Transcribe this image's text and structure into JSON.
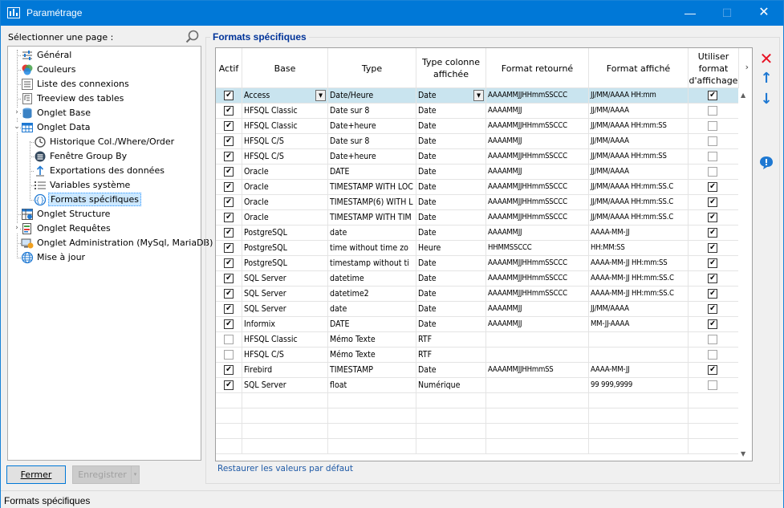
{
  "window": {
    "title": "Paramétrage"
  },
  "left": {
    "label": "Sélectionner une page :"
  },
  "tree": [
    {
      "label": "Général",
      "icon": "settings-sliders-icon",
      "level": 0,
      "expander": ""
    },
    {
      "label": "Couleurs",
      "icon": "color-palette-icon",
      "level": 0,
      "expander": ""
    },
    {
      "label": "Liste des connexions",
      "icon": "list-icon",
      "level": 0,
      "expander": ""
    },
    {
      "label": "Treeview des tables",
      "icon": "treeview-icon",
      "level": 0,
      "expander": ""
    },
    {
      "label": "Onglet Base",
      "icon": "database-icon",
      "level": 0,
      "expander": "›"
    },
    {
      "label": "Onglet Data",
      "icon": "table-icon",
      "level": 0,
      "expander": "⌄"
    },
    {
      "label": "Historique Col./Where/Order",
      "icon": "history-icon",
      "level": 1,
      "expander": ""
    },
    {
      "label": "Fenêtre Group By",
      "icon": "group-by-icon",
      "level": 1,
      "expander": ""
    },
    {
      "label": "Exportations des données",
      "icon": "export-icon",
      "level": 1,
      "expander": ""
    },
    {
      "label": "Variables système",
      "icon": "variables-icon",
      "level": 1,
      "expander": ""
    },
    {
      "label": "Formats spécifiques",
      "icon": "format-braces-icon",
      "level": 1,
      "expander": "",
      "selected": true
    },
    {
      "label": "Onglet Structure",
      "icon": "structure-icon",
      "level": 0,
      "expander": ""
    },
    {
      "label": "Onglet Requêtes",
      "icon": "query-icon",
      "level": 0,
      "expander": "›"
    },
    {
      "label": "Onglet Administration (MySql, MariaDB)",
      "icon": "admin-icon",
      "level": 0,
      "expander": ""
    },
    {
      "label": "Mise à jour",
      "icon": "globe-icon",
      "level": 0,
      "expander": ""
    }
  ],
  "buttons": {
    "close": "Fermer",
    "save": "Enregistrer"
  },
  "group": {
    "title": "Formats spécifiques"
  },
  "table": {
    "headers": [
      "Actif",
      "Base",
      "Type",
      "Type colonne affichée",
      "Format retourné",
      "Format affiché",
      "Utiliser format d'affichage"
    ],
    "rows": [
      {
        "actif": true,
        "base": "Access",
        "type": "Date/Heure",
        "col": "Date",
        "ret": "AAAAMMJJHHmmSSCCC",
        "aff": "JJ/MM/AAAA HH:mm",
        "use": true
      },
      {
        "actif": true,
        "base": "HFSQL Classic",
        "type": "Date sur 8",
        "col": "Date",
        "ret": "AAAAMMJJ",
        "aff": "JJ/MM/AAAA",
        "use": false
      },
      {
        "actif": true,
        "base": "HFSQL Classic",
        "type": "Date+heure",
        "col": "Date",
        "ret": "AAAAMMJJHHmmSSCCC",
        "aff": "JJ/MM/AAAA HH:mm:SS",
        "use": false
      },
      {
        "actif": true,
        "base": "HFSQL C/S",
        "type": "Date sur 8",
        "col": "Date",
        "ret": "AAAAMMJJ",
        "aff": "JJ/MM/AAAA",
        "use": false
      },
      {
        "actif": true,
        "base": "HFSQL C/S",
        "type": "Date+heure",
        "col": "Date",
        "ret": "AAAAMMJJHHmmSSCCC",
        "aff": "JJ/MM/AAAA HH:mm:SS",
        "use": false
      },
      {
        "actif": true,
        "base": "Oracle",
        "type": "DATE",
        "col": "Date",
        "ret": "AAAAMMJJ",
        "aff": "JJ/MM/AAAA",
        "use": false
      },
      {
        "actif": true,
        "base": "Oracle",
        "type": "TIMESTAMP WITH LOC",
        "col": "Date",
        "ret": "AAAAMMJJHHmmSSCCC",
        "aff": "JJ/MM/AAAA HH:mm:SS.C",
        "use": true
      },
      {
        "actif": true,
        "base": "Oracle",
        "type": "TIMESTAMP(6) WITH L",
        "col": "Date",
        "ret": "AAAAMMJJHHmmSSCCC",
        "aff": "JJ/MM/AAAA HH:mm:SS.C",
        "use": true
      },
      {
        "actif": true,
        "base": "Oracle",
        "type": "TIMESTAMP WITH TIM",
        "col": "Date",
        "ret": "AAAAMMJJHHmmSSCCC",
        "aff": "JJ/MM/AAAA HH:mm:SS.C",
        "use": true
      },
      {
        "actif": true,
        "base": "PostgreSQL",
        "type": "date",
        "col": "Date",
        "ret": "AAAAMMJJ",
        "aff": "AAAA-MM-JJ",
        "use": true
      },
      {
        "actif": true,
        "base": "PostgreSQL",
        "type": "time without time zo",
        "col": "Heure",
        "ret": "HHMMSSCCC",
        "aff": "HH:MM:SS",
        "use": true
      },
      {
        "actif": true,
        "base": "PostgreSQL",
        "type": "timestamp without ti",
        "col": "Date",
        "ret": "AAAAMMJJHHmmSSCCC",
        "aff": "AAAA-MM-JJ HH:mm:SS",
        "use": true
      },
      {
        "actif": true,
        "base": "SQL Server",
        "type": "datetime",
        "col": "Date",
        "ret": "AAAAMMJJHHmmSSCCC",
        "aff": "AAAA-MM-JJ HH:mm:SS.C",
        "use": true
      },
      {
        "actif": true,
        "base": "SQL Server",
        "type": "datetime2",
        "col": "Date",
        "ret": "AAAAMMJJHHmmSSCCC",
        "aff": "AAAA-MM-JJ HH:mm:SS.C",
        "use": true
      },
      {
        "actif": true,
        "base": "SQL Server",
        "type": "date",
        "col": "Date",
        "ret": "AAAAMMJJ",
        "aff": "JJ/MM/AAAA",
        "use": true
      },
      {
        "actif": true,
        "base": "Informix",
        "type": "DATE",
        "col": "Date",
        "ret": "AAAAMMJJ",
        "aff": "MM-JJ-AAAA",
        "use": true
      },
      {
        "actif": false,
        "base": "HFSQL Classic",
        "type": "Mémo Texte",
        "col": "RTF",
        "ret": "",
        "aff": "",
        "use": false
      },
      {
        "actif": false,
        "base": "HFSQL C/S",
        "type": "Mémo Texte",
        "col": "RTF",
        "ret": "",
        "aff": "",
        "use": false
      },
      {
        "actif": true,
        "base": "Firebird",
        "type": "TIMESTAMP",
        "col": "Date",
        "ret": "AAAAMMJJHHmmSS",
        "aff": "AAAA-MM-JJ",
        "use": true
      },
      {
        "actif": true,
        "base": "SQL Server",
        "type": "float",
        "col": "Numérique",
        "ret": "",
        "aff": "99 999,9999",
        "use": false
      }
    ]
  },
  "restore_link": "Restaurer les valeurs par défaut",
  "status": {
    "text": "Formats spécifiques"
  },
  "colors": {
    "accent": "#0078d7",
    "selection": "#c9e4ef",
    "delete": "#e81123",
    "arrows": "#1e78d2"
  }
}
